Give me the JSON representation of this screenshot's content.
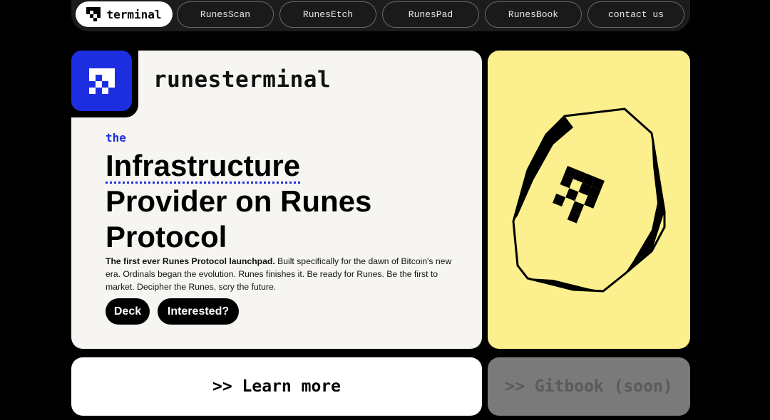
{
  "nav": {
    "brand_label": "terminal",
    "items": [
      {
        "label": "RunesScan"
      },
      {
        "label": "RunesEtch"
      },
      {
        "label": "RunesPad"
      },
      {
        "label": "RunesBook"
      },
      {
        "label": "contact us"
      }
    ]
  },
  "hero": {
    "brand_title": "runesterminal",
    "kicker": "the",
    "headline_line1": "Infrastructure",
    "headline_line2": "Provider on Runes",
    "headline_line3": "Protocol",
    "desc_bold": "The first ever Runes Protocol launchpad.",
    "desc_rest": " Built specifically for the dawn of Bitcoin's new era. Ordinals began the evolution. Runes finishes it. Be ready for Runes. Be the first to market. Decipher the Runes, scry the future.",
    "buttons": {
      "deck": "Deck",
      "interested": "Interested?"
    }
  },
  "cta": {
    "learn_more": ">> Learn more",
    "gitbook": ">> Gitbook (soon)"
  },
  "colors": {
    "accent": "#1d2ee0",
    "yellow_card": "#fbf08d",
    "card_bg": "#f6f5f1",
    "page_bg": "#000000"
  },
  "icons": {
    "brand": "runes-logo-icon",
    "hero_art": "rune-stone-icon"
  }
}
